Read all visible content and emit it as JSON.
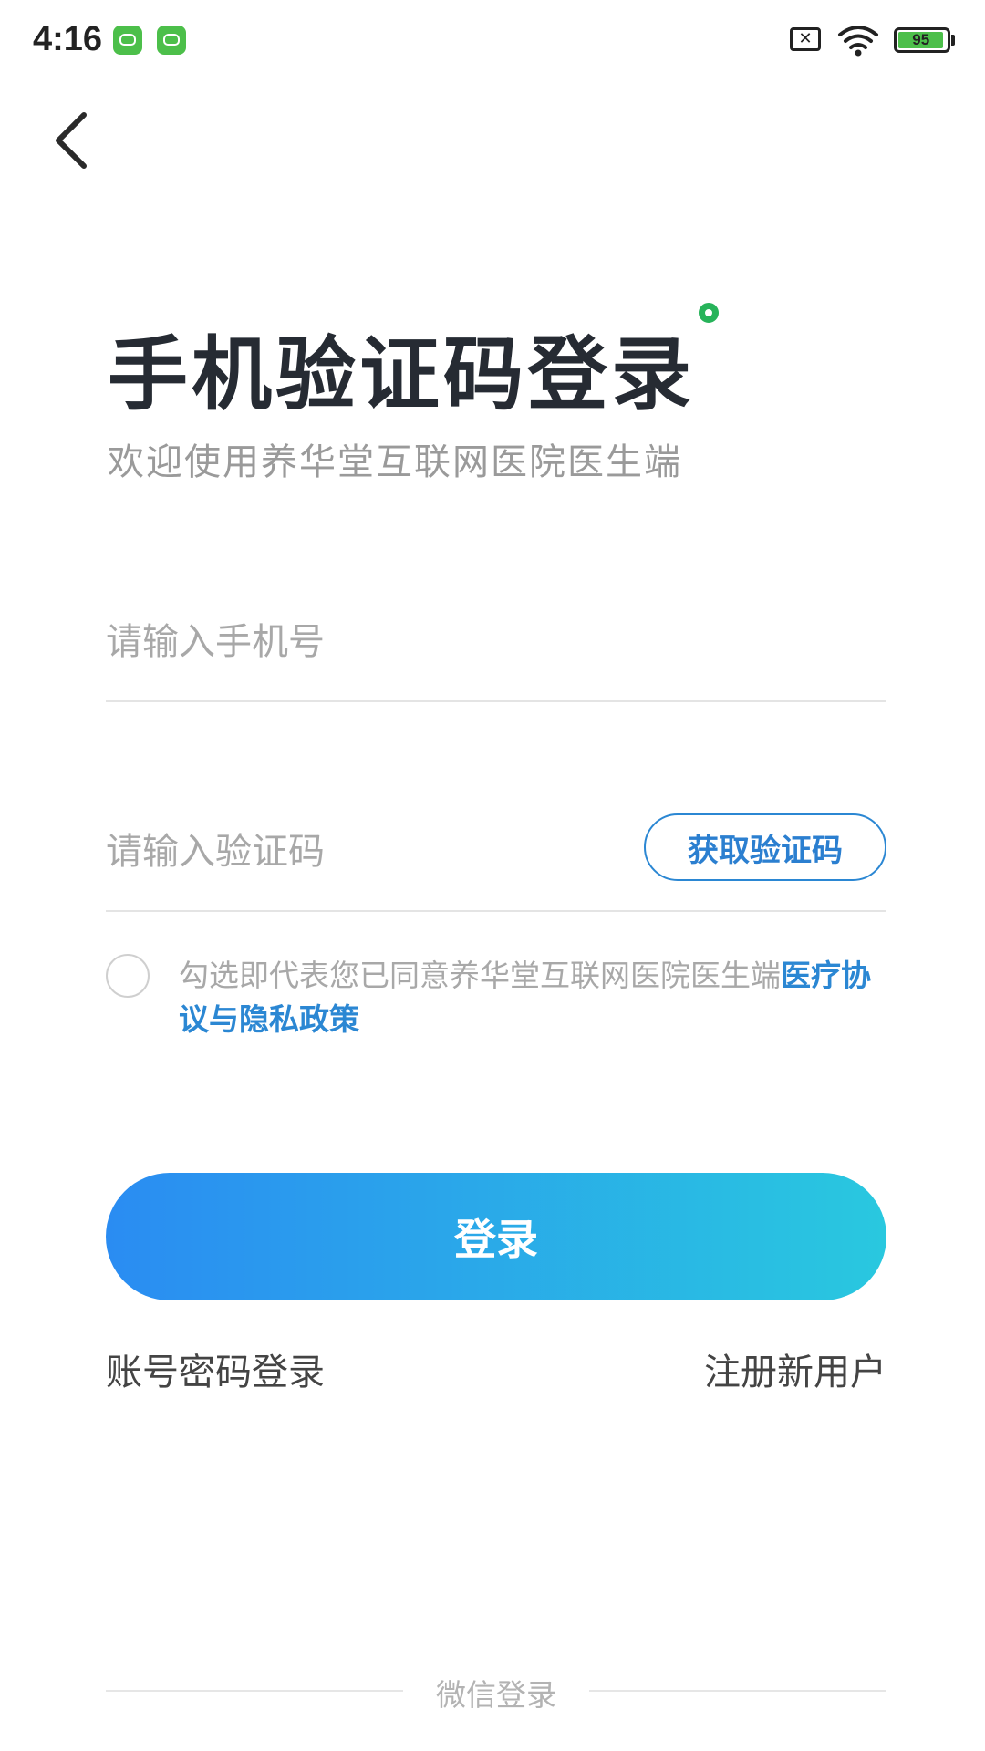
{
  "status_bar": {
    "time": "4:16",
    "battery_level": "95",
    "sim_glyph": "✕"
  },
  "header": {
    "title": "手机验证码登录",
    "subtitle": "欢迎使用养华堂互联网医院医生端"
  },
  "form": {
    "phone_placeholder": "请输入手机号",
    "code_placeholder": "请输入验证码",
    "get_code_label": "获取验证码"
  },
  "agreement": {
    "text": "勾选即代表您已同意养华堂互联网医院医生端",
    "link": "医疗协议与隐私政策",
    "checked": false
  },
  "actions": {
    "login_label": "登录",
    "password_login_label": "账号密码登录",
    "register_label": "注册新用户"
  },
  "footer": {
    "wechat_label": "微信登录"
  },
  "colors": {
    "accent_blue": "#2b87d3",
    "gradient_start": "#2a8cf2",
    "gradient_end": "#29c8df",
    "title_dot": "#27b35a"
  },
  "icons": [
    "app-notification-icon",
    "sim-error-icon",
    "wifi-icon",
    "battery-icon",
    "back-arrow-icon"
  ]
}
